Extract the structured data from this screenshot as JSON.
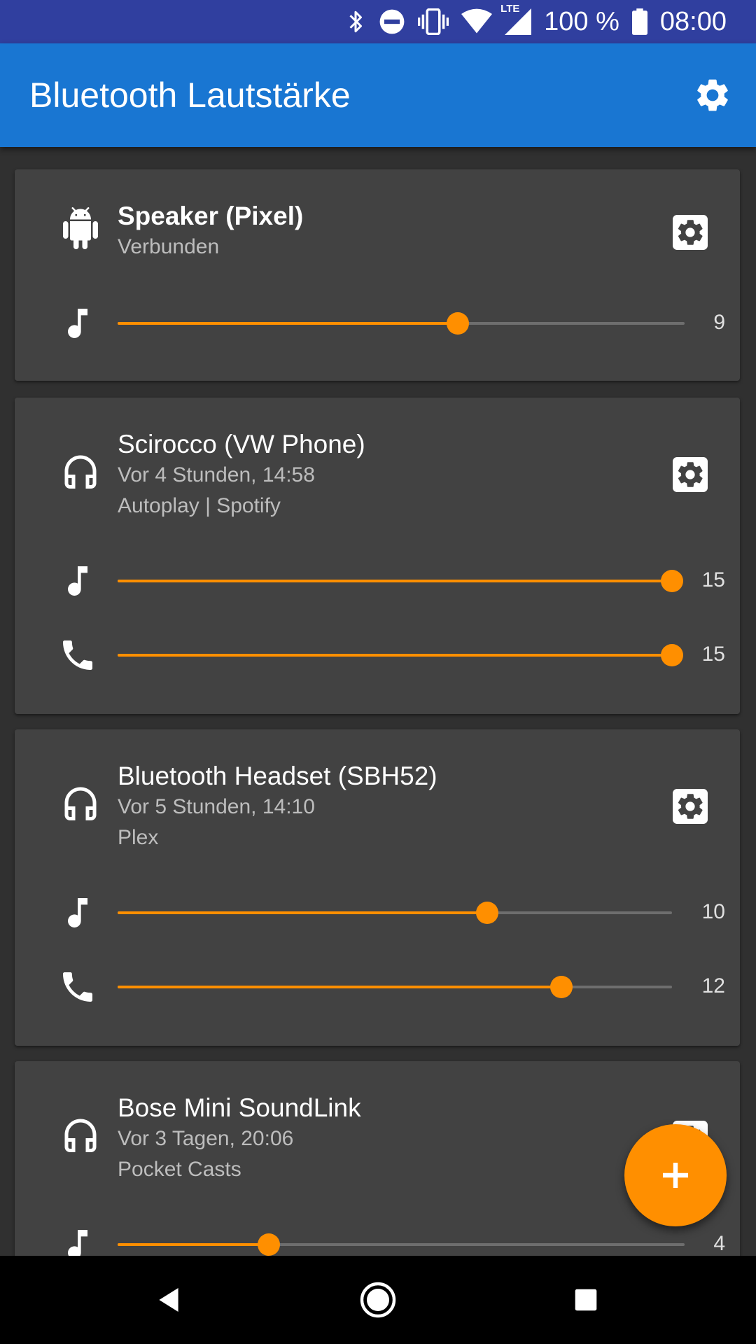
{
  "status_bar": {
    "battery_text": "100 %",
    "time": "08:00",
    "network": "LTE",
    "icons": [
      "bluetooth-icon",
      "dnd-icon",
      "vibrate-icon",
      "wifi-icon",
      "signal-icon",
      "battery-icon"
    ]
  },
  "app_bar": {
    "title": "Bluetooth Lautstärke",
    "settings_icon": "settings-icon"
  },
  "colors": {
    "status_bar": "#303F9F",
    "app_bar": "#1976D2",
    "background": "#303030",
    "card": "#424242",
    "accent": "#FF8F00"
  },
  "devices": [
    {
      "name": "Speaker (Pixel)",
      "type_icon": "android-icon",
      "lines": [
        "Verbunden"
      ],
      "connected": true,
      "sliders": [
        {
          "kind": "music",
          "icon": "music-note-icon",
          "value": 9,
          "level": 0.6
        }
      ]
    },
    {
      "name": "Scirocco (VW Phone)",
      "type_icon": "headphones-icon",
      "lines": [
        "Vor 4 Stunden, 14:58",
        "Autoplay | Spotify"
      ],
      "connected": false,
      "sliders": [
        {
          "kind": "music",
          "icon": "music-note-icon",
          "value": 15,
          "level": 1.0
        },
        {
          "kind": "call",
          "icon": "phone-icon",
          "value": 15,
          "level": 1.0
        }
      ]
    },
    {
      "name": "Bluetooth Headset (SBH52)",
      "type_icon": "headphones-icon",
      "lines": [
        "Vor 5 Stunden, 14:10",
        "Plex"
      ],
      "connected": false,
      "sliders": [
        {
          "kind": "music",
          "icon": "music-note-icon",
          "value": 10,
          "level": 0.667
        },
        {
          "kind": "call",
          "icon": "phone-icon",
          "value": 12,
          "level": 0.8
        }
      ]
    },
    {
      "name": "Bose Mini SoundLink",
      "type_icon": "headphones-icon",
      "lines": [
        "Vor 3 Tagen, 20:06",
        "Pocket Casts"
      ],
      "connected": false,
      "sliders": [
        {
          "kind": "music",
          "icon": "music-note-icon",
          "value": 4,
          "level": 0.267
        }
      ]
    }
  ],
  "fab": {
    "icon": "plus-icon"
  },
  "nav_bar": {
    "buttons": [
      "back-icon",
      "home-icon",
      "recents-icon"
    ]
  }
}
